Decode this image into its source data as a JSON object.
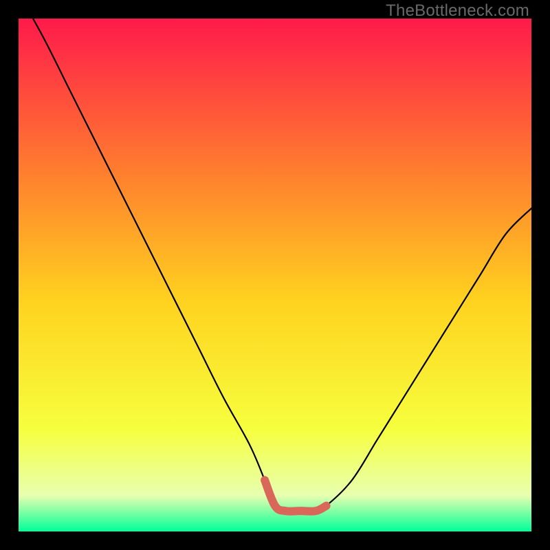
{
  "watermark": "TheBottleneck.com",
  "colors": {
    "bg_black": "#000000",
    "watermark": "#696969",
    "curve": "#000000",
    "flat_segment": "#d9675a",
    "grad_top": "#ff1a4b",
    "grad_mid_upper": "#ff7e2e",
    "grad_mid": "#ffd21f",
    "grad_mid_lower": "#f6ff3d",
    "grad_near_bottom": "#e8ffb0",
    "grad_bottom": "#00ff99"
  },
  "chart_data": {
    "type": "line",
    "title": "",
    "xlabel": "",
    "ylabel": "",
    "xlim": [
      0,
      100
    ],
    "ylim": [
      0,
      100
    ],
    "grid": false,
    "legend_position": "none",
    "series": [
      {
        "name": "bottleneck-curve",
        "x": [
          0,
          5,
          10,
          15,
          20,
          25,
          30,
          35,
          40,
          45,
          48,
          50,
          52,
          55,
          58,
          60,
          65,
          70,
          75,
          80,
          85,
          90,
          95,
          100
        ],
        "values": [
          105,
          96,
          86,
          76,
          66,
          56,
          46,
          36,
          26,
          17,
          10,
          5,
          4,
          4,
          4,
          5,
          10,
          18,
          26,
          34,
          42,
          50,
          58,
          63
        ]
      },
      {
        "name": "flat-highlight",
        "x": [
          48,
          50,
          52,
          55,
          58,
          60
        ],
        "values": [
          10,
          5,
          4,
          4,
          4,
          5
        ]
      }
    ],
    "annotations": []
  }
}
